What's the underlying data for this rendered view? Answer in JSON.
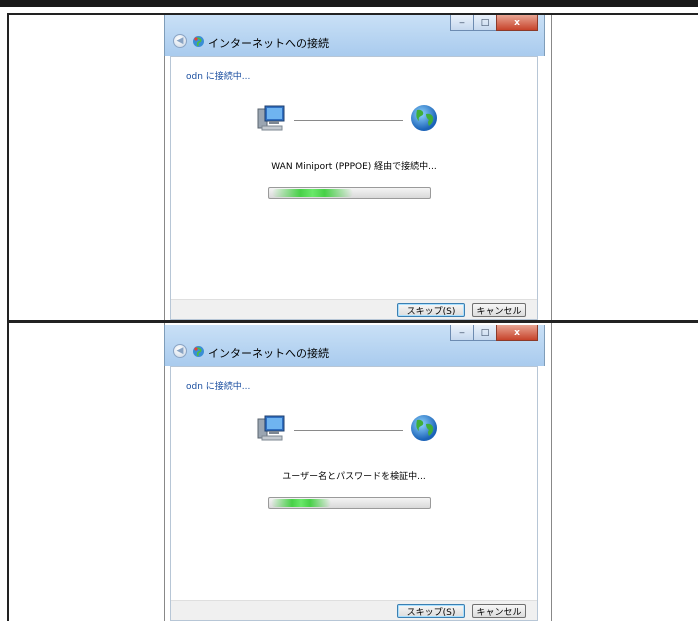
{
  "screens": [
    {
      "title": "インターネットへの接続",
      "window_buttons": {
        "minimize": "‒",
        "maximize": "□",
        "close": "x"
      },
      "heading": "odn に接続中...",
      "status": "WAN Miniport (PPPOE) 経由で接続中...",
      "progress": 0.2,
      "buttons": {
        "skip": "スキップ(S)",
        "cancel": "キャンセル"
      }
    },
    {
      "title": "インターネットへの接続",
      "window_buttons": {
        "minimize": "‒",
        "maximize": "□",
        "close": "x"
      },
      "heading": "odn に接続中...",
      "status": "ユーザー名とパスワードを検証中...",
      "progress": 0.15,
      "buttons": {
        "skip": "スキップ(S)",
        "cancel": "キャンセル"
      }
    }
  ],
  "colors": {
    "accent_heading": "#1b4fa0",
    "progress_green": "#48d048",
    "close_red": "#c7432a"
  },
  "icons": [
    "back-arrow-icon",
    "network-icon",
    "computer-icon",
    "globe-icon"
  ]
}
